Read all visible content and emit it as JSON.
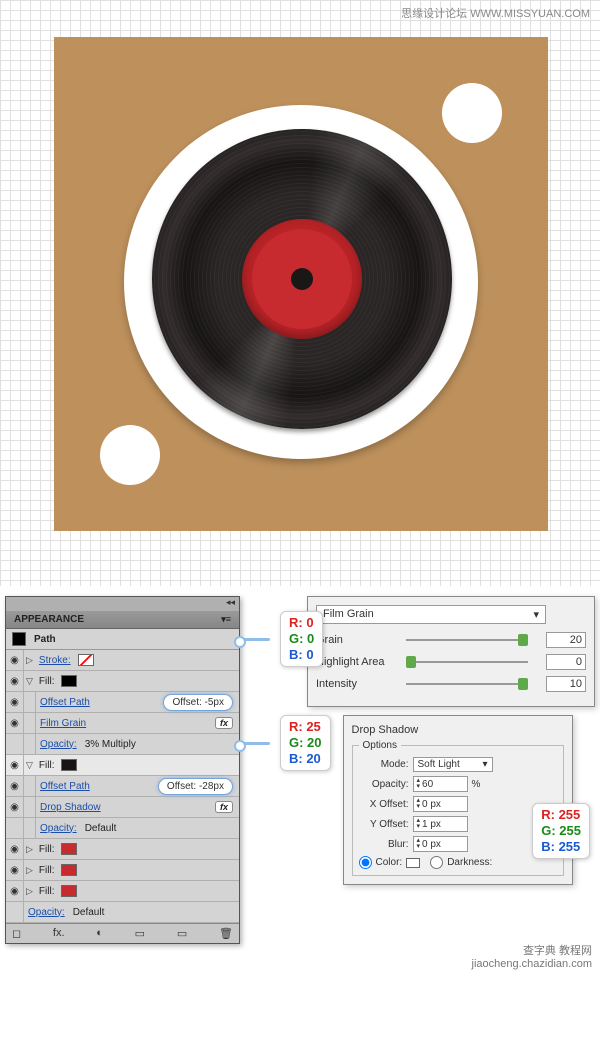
{
  "watermark_top": "思缘设计论坛 WWW.MISSYUAN.COM",
  "watermark_bottom_1": "查字典 教程网",
  "watermark_bottom_2": "jiaocheng.chazidian.com",
  "panel": {
    "title": "APPEARANCE",
    "path_label": "Path",
    "stroke_label": "Stroke:",
    "fill_label": "Fill:",
    "offset_path": "Offset Path",
    "film_grain": "Film Grain",
    "drop_shadow": "Drop Shadow",
    "opacity_label": "Opacity:",
    "opacity_3m": "3% Multiply",
    "opacity_def": "Default",
    "offset_v1": "Offset: -5px",
    "offset_v2": "Offset: -28px",
    "fx": "fx"
  },
  "rgb0": {
    "r": "R: 0",
    "g": "G: 0",
    "b": "B: 0"
  },
  "rgb1": {
    "r": "R: 25",
    "g": "G: 20",
    "b": "B: 20"
  },
  "rgb255": {
    "r": "R: 255",
    "g": "G: 255",
    "b": "B: 255"
  },
  "filmgrain": {
    "name": "Film Grain",
    "grain_label": "Grain",
    "grain_val": "20",
    "highlight_label": "Highlight Area",
    "highlight_val": "0",
    "intensity_label": "Intensity",
    "intensity_val": "10"
  },
  "dropshadow": {
    "title": "Drop Shadow",
    "options": "Options",
    "mode_label": "Mode:",
    "mode_val": "Soft Light",
    "opacity_label": "Opacity:",
    "opacity_val": "60",
    "pct": "%",
    "xoff_label": "X Offset:",
    "xoff_val": "0 px",
    "yoff_label": "Y Offset:",
    "yoff_val": "1 px",
    "blur_label": "Blur:",
    "blur_val": "0 px",
    "color_label": "Color:",
    "darkness_label": "Darkness:"
  },
  "footer_icons": {
    "clear": "◻",
    "fx": "fx.",
    "dup": "◐",
    "new": "▭",
    "trash": "🗑"
  }
}
